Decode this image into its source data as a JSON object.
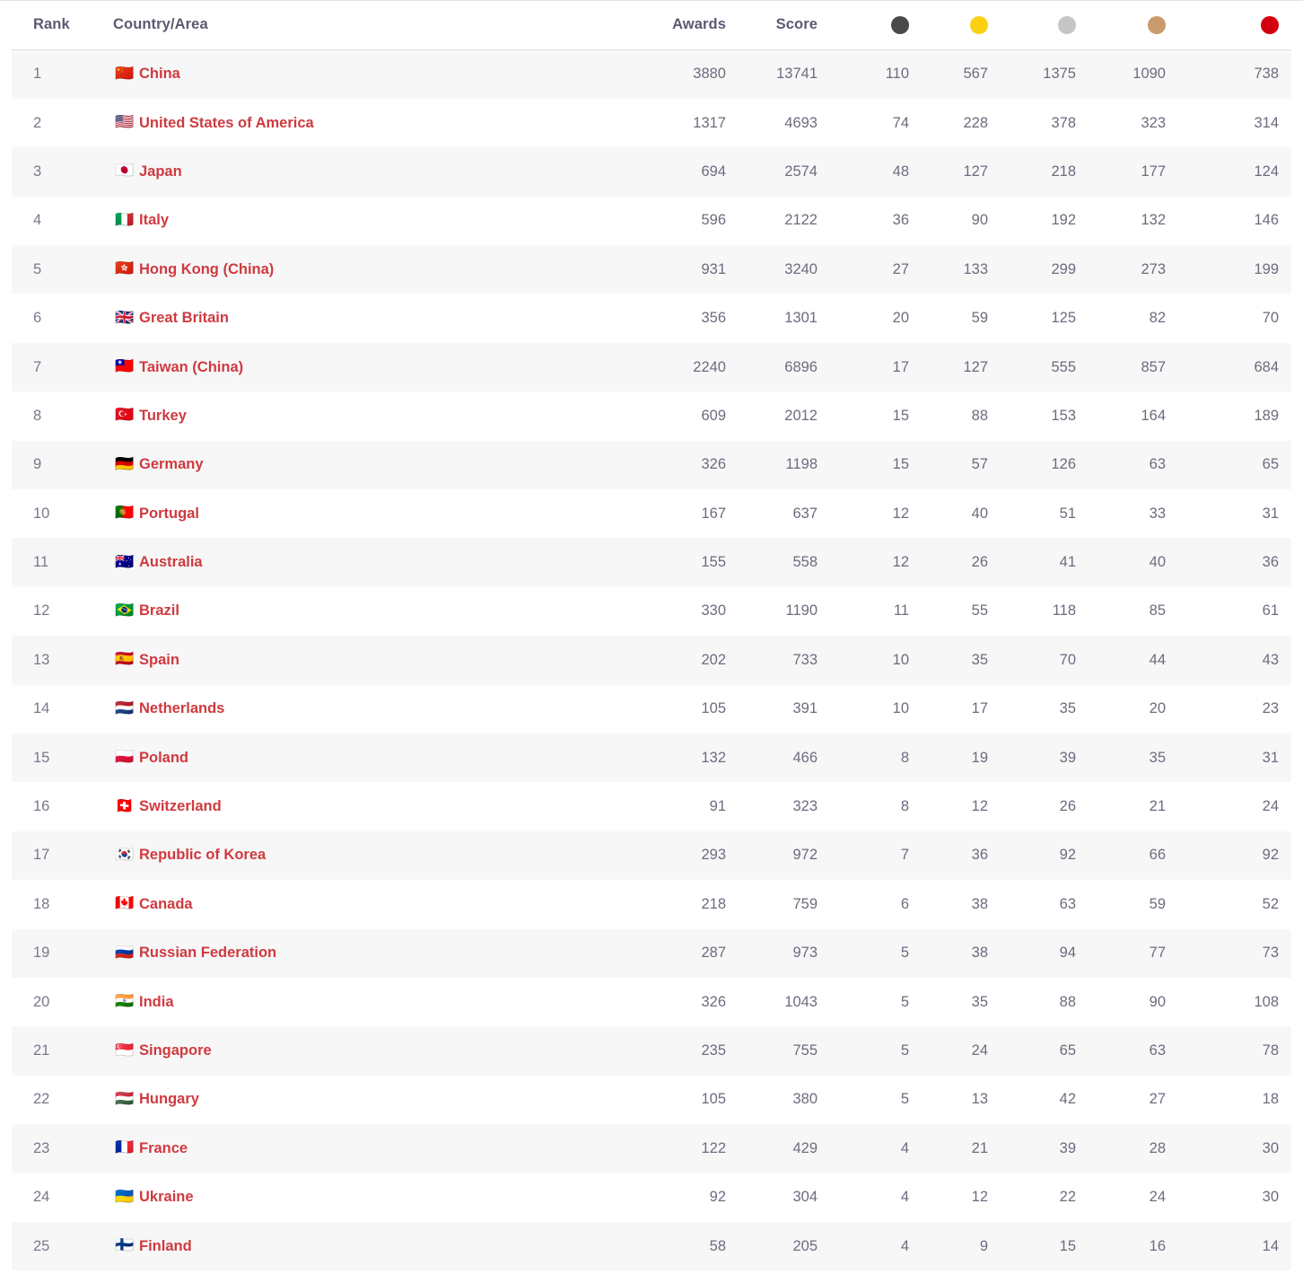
{
  "table": {
    "headers": {
      "rank": "Rank",
      "country": "Country/Area",
      "awards": "Awards",
      "score": "Score",
      "medal_total": "total-medal-icon",
      "medal_gold": "gold-medal-icon",
      "medal_silver": "silver-medal-icon",
      "medal_bronze": "bronze-medal-icon",
      "medal_red": "red-medal-icon"
    },
    "colors": {
      "medal_total": "#4a4a4a",
      "medal_gold": "#fcd113",
      "medal_silver": "#c6c6c6",
      "medal_bronze": "#c99a6a",
      "medal_red": "#d4000d",
      "country_name": "#cf3a3f",
      "header_text": "#5b5a72",
      "cell_text": "#6c6c7e",
      "row_stripe": "#f7f7f8"
    },
    "rows": [
      {
        "rank": "1",
        "flag": "🇨🇳",
        "country": "China",
        "awards": "3880",
        "score": "13741",
        "m1": "110",
        "m2": "567",
        "m3": "1375",
        "m4": "1090",
        "m5": "738"
      },
      {
        "rank": "2",
        "flag": "🇺🇸",
        "country": "United States of America",
        "awards": "1317",
        "score": "4693",
        "m1": "74",
        "m2": "228",
        "m3": "378",
        "m4": "323",
        "m5": "314"
      },
      {
        "rank": "3",
        "flag": "🇯🇵",
        "country": "Japan",
        "awards": "694",
        "score": "2574",
        "m1": "48",
        "m2": "127",
        "m3": "218",
        "m4": "177",
        "m5": "124"
      },
      {
        "rank": "4",
        "flag": "🇮🇹",
        "country": "Italy",
        "awards": "596",
        "score": "2122",
        "m1": "36",
        "m2": "90",
        "m3": "192",
        "m4": "132",
        "m5": "146"
      },
      {
        "rank": "5",
        "flag": "🇭🇰",
        "country": "Hong Kong (China)",
        "awards": "931",
        "score": "3240",
        "m1": "27",
        "m2": "133",
        "m3": "299",
        "m4": "273",
        "m5": "199"
      },
      {
        "rank": "6",
        "flag": "🇬🇧",
        "country": "Great Britain",
        "awards": "356",
        "score": "1301",
        "m1": "20",
        "m2": "59",
        "m3": "125",
        "m4": "82",
        "m5": "70"
      },
      {
        "rank": "7",
        "flag": "🇹🇼",
        "country": "Taiwan (China)",
        "awards": "2240",
        "score": "6896",
        "m1": "17",
        "m2": "127",
        "m3": "555",
        "m4": "857",
        "m5": "684"
      },
      {
        "rank": "8",
        "flag": "🇹🇷",
        "country": "Turkey",
        "awards": "609",
        "score": "2012",
        "m1": "15",
        "m2": "88",
        "m3": "153",
        "m4": "164",
        "m5": "189"
      },
      {
        "rank": "9",
        "flag": "🇩🇪",
        "country": "Germany",
        "awards": "326",
        "score": "1198",
        "m1": "15",
        "m2": "57",
        "m3": "126",
        "m4": "63",
        "m5": "65"
      },
      {
        "rank": "10",
        "flag": "🇵🇹",
        "country": "Portugal",
        "awards": "167",
        "score": "637",
        "m1": "12",
        "m2": "40",
        "m3": "51",
        "m4": "33",
        "m5": "31"
      },
      {
        "rank": "11",
        "flag": "🇦🇺",
        "country": "Australia",
        "awards": "155",
        "score": "558",
        "m1": "12",
        "m2": "26",
        "m3": "41",
        "m4": "40",
        "m5": "36"
      },
      {
        "rank": "12",
        "flag": "🇧🇷",
        "country": "Brazil",
        "awards": "330",
        "score": "1190",
        "m1": "11",
        "m2": "55",
        "m3": "118",
        "m4": "85",
        "m5": "61"
      },
      {
        "rank": "13",
        "flag": "🇪🇸",
        "country": "Spain",
        "awards": "202",
        "score": "733",
        "m1": "10",
        "m2": "35",
        "m3": "70",
        "m4": "44",
        "m5": "43"
      },
      {
        "rank": "14",
        "flag": "🇳🇱",
        "country": "Netherlands",
        "awards": "105",
        "score": "391",
        "m1": "10",
        "m2": "17",
        "m3": "35",
        "m4": "20",
        "m5": "23"
      },
      {
        "rank": "15",
        "flag": "🇵🇱",
        "country": "Poland",
        "awards": "132",
        "score": "466",
        "m1": "8",
        "m2": "19",
        "m3": "39",
        "m4": "35",
        "m5": "31"
      },
      {
        "rank": "16",
        "flag": "🇨🇭",
        "country": "Switzerland",
        "awards": "91",
        "score": "323",
        "m1": "8",
        "m2": "12",
        "m3": "26",
        "m4": "21",
        "m5": "24"
      },
      {
        "rank": "17",
        "flag": "🇰🇷",
        "country": "Republic of Korea",
        "awards": "293",
        "score": "972",
        "m1": "7",
        "m2": "36",
        "m3": "92",
        "m4": "66",
        "m5": "92"
      },
      {
        "rank": "18",
        "flag": "🇨🇦",
        "country": "Canada",
        "awards": "218",
        "score": "759",
        "m1": "6",
        "m2": "38",
        "m3": "63",
        "m4": "59",
        "m5": "52"
      },
      {
        "rank": "19",
        "flag": "🇷🇺",
        "country": "Russian Federation",
        "awards": "287",
        "score": "973",
        "m1": "5",
        "m2": "38",
        "m3": "94",
        "m4": "77",
        "m5": "73"
      },
      {
        "rank": "20",
        "flag": "🇮🇳",
        "country": "India",
        "awards": "326",
        "score": "1043",
        "m1": "5",
        "m2": "35",
        "m3": "88",
        "m4": "90",
        "m5": "108"
      },
      {
        "rank": "21",
        "flag": "🇸🇬",
        "country": "Singapore",
        "awards": "235",
        "score": "755",
        "m1": "5",
        "m2": "24",
        "m3": "65",
        "m4": "63",
        "m5": "78"
      },
      {
        "rank": "22",
        "flag": "🇭🇺",
        "country": "Hungary",
        "awards": "105",
        "score": "380",
        "m1": "5",
        "m2": "13",
        "m3": "42",
        "m4": "27",
        "m5": "18"
      },
      {
        "rank": "23",
        "flag": "🇫🇷",
        "country": "France",
        "awards": "122",
        "score": "429",
        "m1": "4",
        "m2": "21",
        "m3": "39",
        "m4": "28",
        "m5": "30"
      },
      {
        "rank": "24",
        "flag": "🇺🇦",
        "country": "Ukraine",
        "awards": "92",
        "score": "304",
        "m1": "4",
        "m2": "12",
        "m3": "22",
        "m4": "24",
        "m5": "30"
      },
      {
        "rank": "25",
        "flag": "🇫🇮",
        "country": "Finland",
        "awards": "58",
        "score": "205",
        "m1": "4",
        "m2": "9",
        "m3": "15",
        "m4": "16",
        "m5": "14"
      }
    ]
  }
}
